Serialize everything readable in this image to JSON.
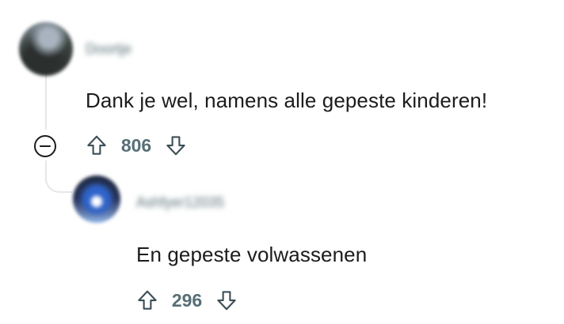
{
  "comments": [
    {
      "username": "Doortje",
      "body": "Dank je wel, namens alle gepeste kinderen!",
      "upvote_icon": "arrow-up-outline-icon",
      "downvote_icon": "arrow-down-outline-icon",
      "score": "806"
    },
    {
      "username": "Ashfyer12035",
      "body": "En gepeste volwassenen",
      "upvote_icon": "arrow-up-outline-icon",
      "downvote_icon": "arrow-down-outline-icon",
      "score": "296"
    }
  ],
  "thread": {
    "collapse_icon": "minus-circle-icon"
  },
  "colors": {
    "text": "#1c1c1c",
    "meta": "#576f76",
    "thread_line": "#e5e7e9"
  }
}
